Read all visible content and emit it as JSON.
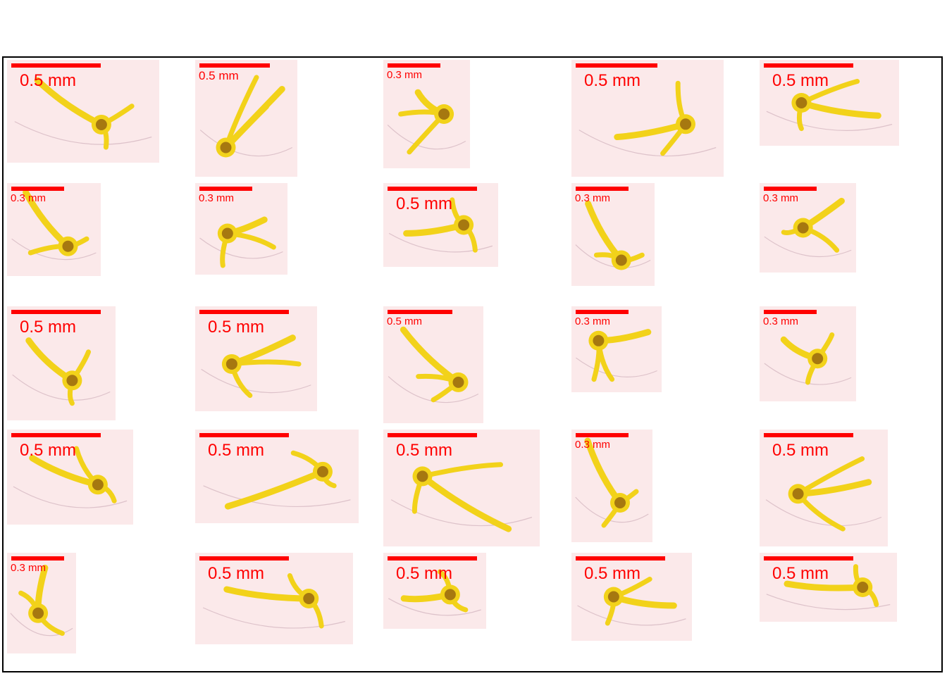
{
  "figure": {
    "panels": [
      {
        "scale": "0.5 mm"
      },
      {
        "scale": "0.5 mm"
      },
      {
        "scale": "0.3 mm"
      },
      {
        "scale": "0.5 mm"
      },
      {
        "scale": "0.5 mm"
      },
      {
        "scale": "0.3 mm"
      },
      {
        "scale": "0.3 mm"
      },
      {
        "scale": "0.5 mm"
      },
      {
        "scale": "0.3 mm"
      },
      {
        "scale": "0.3 mm"
      },
      {
        "scale": "0.5 mm"
      },
      {
        "scale": "0.5 mm"
      },
      {
        "scale": "0.5 mm"
      },
      {
        "scale": "0.3 mm"
      },
      {
        "scale": "0.3 mm"
      },
      {
        "scale": "0.5 mm"
      },
      {
        "scale": "0.5 mm"
      },
      {
        "scale": "0.5 mm"
      },
      {
        "scale": "0.3 mm"
      },
      {
        "scale": "0.5 mm"
      },
      {
        "scale": "0.3 mm"
      },
      {
        "scale": "0.5 mm"
      },
      {
        "scale": "0.5 mm"
      },
      {
        "scale": "0.5 mm"
      },
      {
        "scale": "0.5 mm"
      }
    ]
  },
  "colors": {
    "scale_bar": "#ff0000",
    "specimen": "#f2d21a",
    "specimen_center": "#8c5a0e",
    "background": "#fbe9ea"
  }
}
